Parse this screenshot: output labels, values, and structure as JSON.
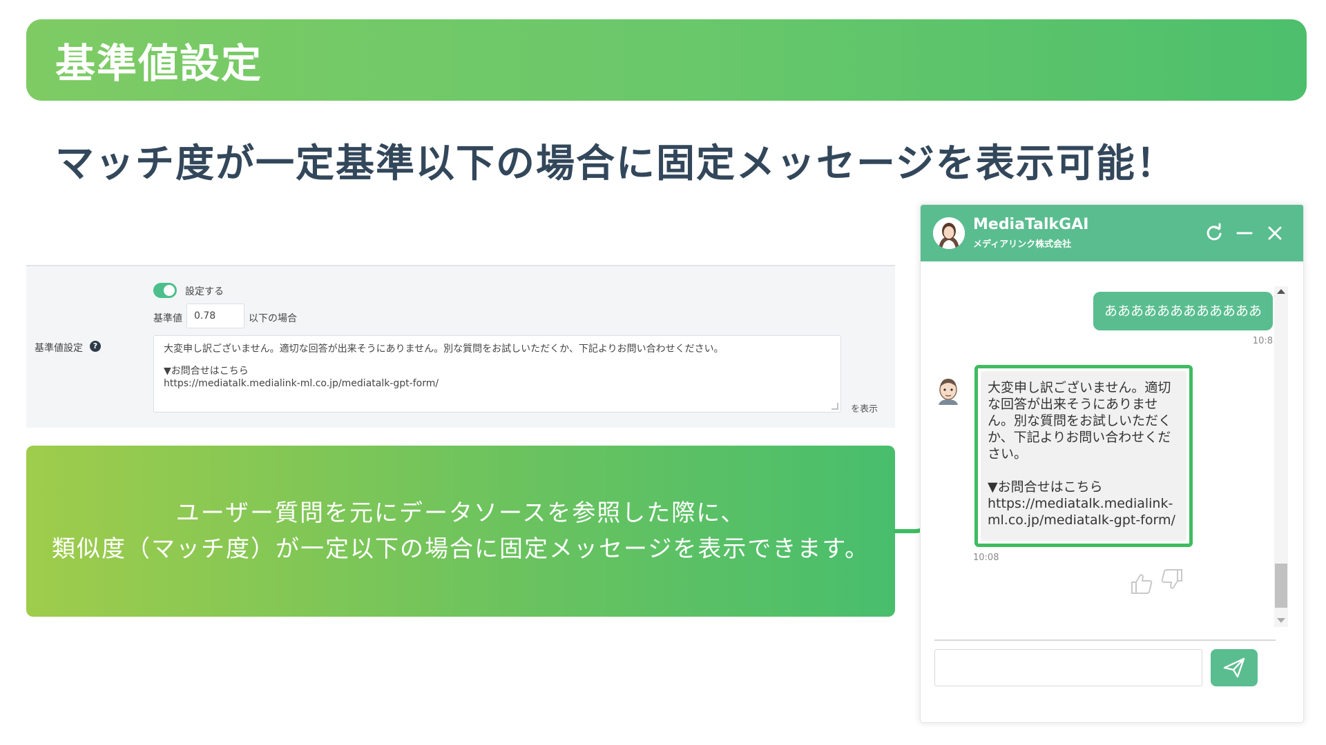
{
  "slide": {
    "title": "基準値設定",
    "subtitle": "マッチ度が一定基準以下の場合に固定メッセージを表示可能！"
  },
  "settings": {
    "toggle_label": "設定する",
    "toggle_on": true,
    "threshold_label": "基準値",
    "threshold_value": "0.78",
    "below_label": "以下の場合",
    "row_label": "基準値設定",
    "help_icon": "?",
    "message_line1": "大変申し訳ございません。適切な回答が出来そうにありません。別な質問をお試しいただくか、下記よりお問い合わせください。",
    "message_line2": "▼お問合せはこちら",
    "message_line3": "https://mediatalk.medialink-ml.co.jp/mediatalk-gpt-form/",
    "display_label": "を表示"
  },
  "description": {
    "line1": "ユーザー質問を元にデータソースを参照した際に、",
    "line2": "類似度（マッチ度）が一定以下の場合に固定メッセージを表示できます。"
  },
  "chat": {
    "header_title": "MediaTalkGAI",
    "header_company": "メディアリンク株式会社",
    "user_message": "ああああああああああああ",
    "user_time": "10:8",
    "bot_message": "大変申し訳ございません。適切な回答が出来そうにありません。別な質問をお試しいただくか、下記よりお問い合わせください。\n\n▼お問合せはこちら\nhttps://mediatalk.medialink-ml.co.jp/mediatalk-gpt-form/",
    "bot_time": "10:08",
    "input_value": "",
    "input_placeholder": "",
    "scroll_position": 0.85
  },
  "icons": {
    "header_avatar": "operator-avatar-icon",
    "refresh": "refresh-icon",
    "minimize": "minimize-icon",
    "close": "close-icon",
    "bot_avatar": "bot-avatar-icon",
    "thumbs_up": "thumbs-up-icon",
    "thumbs_down": "thumbs-down-icon",
    "send": "send-icon"
  },
  "colors": {
    "banner_green": "#6ac86a",
    "chat_green": "#5abd8f",
    "highlight_green": "#3ebc60",
    "subtitle_text": "#33475b"
  }
}
